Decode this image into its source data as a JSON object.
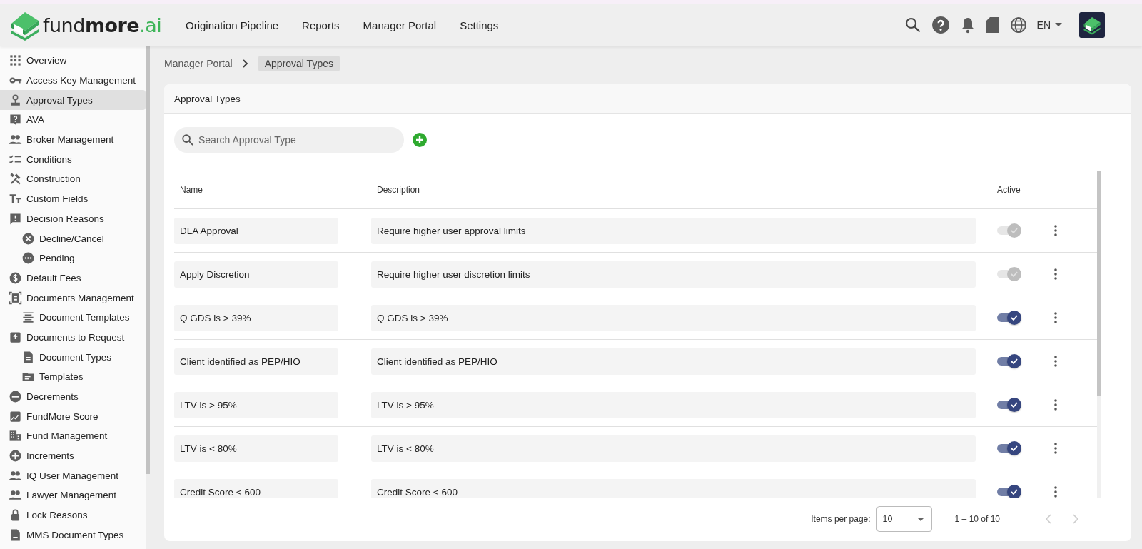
{
  "logo": {
    "segments": [
      "fund",
      "more",
      ".ai"
    ]
  },
  "nav": [
    {
      "label": "Origination Pipeline"
    },
    {
      "label": "Reports"
    },
    {
      "label": "Manager Portal"
    },
    {
      "label": "Settings"
    }
  ],
  "header_tools": {
    "language": "EN"
  },
  "sidebar": {
    "items": [
      {
        "label": "Overview",
        "selected": false
      },
      {
        "label": "Access Key Management",
        "selected": false
      },
      {
        "label": "Approval Types",
        "selected": true
      },
      {
        "label": "AVA",
        "selected": false
      },
      {
        "label": "Broker Management",
        "selected": false
      },
      {
        "label": "Conditions",
        "selected": false
      },
      {
        "label": "Construction",
        "selected": false
      },
      {
        "label": "Custom Fields",
        "selected": false
      },
      {
        "label": "Decision Reasons",
        "selected": false,
        "children": [
          {
            "label": "Decline/Cancel",
            "selected": false
          },
          {
            "label": "Pending",
            "selected": false
          }
        ]
      },
      {
        "label": "Default Fees",
        "selected": false
      },
      {
        "label": "Documents Management",
        "selected": false,
        "children": [
          {
            "label": "Document Templates",
            "selected": false
          }
        ]
      },
      {
        "label": "Documents to Request",
        "selected": false,
        "children": [
          {
            "label": "Document Types",
            "selected": false
          },
          {
            "label": "Templates",
            "selected": false
          }
        ]
      },
      {
        "label": "Decrements",
        "selected": false
      },
      {
        "label": "FundMore Score",
        "selected": false
      },
      {
        "label": "Fund Management",
        "selected": false
      },
      {
        "label": "Increments",
        "selected": false
      },
      {
        "label": "IQ User Management",
        "selected": false
      },
      {
        "label": "Lawyer Management",
        "selected": false
      },
      {
        "label": "Lock Reasons",
        "selected": false
      },
      {
        "label": "MMS Document Types",
        "selected": false
      }
    ]
  },
  "breadcrumb": [
    {
      "label": "Manager Portal",
      "current": false
    },
    {
      "label": "Approval Types",
      "current": true
    }
  ],
  "card": {
    "title": "Approval Types",
    "search": {
      "placeholder": "Search Approval Type"
    },
    "table": {
      "columns": [
        "Name",
        "Description",
        "Active"
      ],
      "rows": [
        {
          "name": "DLA Approval",
          "description": "Require higher user approval limits",
          "active": true,
          "disabled": true
        },
        {
          "name": "Apply Discretion",
          "description": "Require higher user discretion limits",
          "active": true,
          "disabled": true
        },
        {
          "name": "Q GDS is > 39%",
          "description": "Q GDS is > 39%",
          "active": true,
          "disabled": false
        },
        {
          "name": "Client identified as PEP/HIO",
          "description": "Client identified as PEP/HIO",
          "active": true,
          "disabled": false
        },
        {
          "name": "LTV is > 95%",
          "description": "LTV is > 95%",
          "active": true,
          "disabled": false
        },
        {
          "name": "LTV is < 80%",
          "description": "LTV is < 80%",
          "active": true,
          "disabled": false
        },
        {
          "name": "Credit Score < 600",
          "description": "Credit Score < 600",
          "active": true,
          "disabled": false
        }
      ]
    },
    "paginator": {
      "label": "Items per page:",
      "page_size": "10",
      "range": "1 – 10 of 10"
    }
  }
}
